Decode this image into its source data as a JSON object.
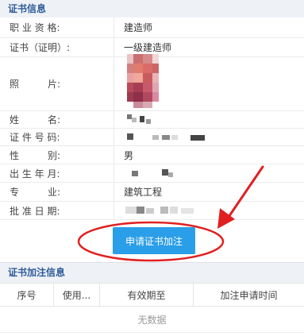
{
  "cert_info": {
    "title": "证书信息",
    "rows": [
      {
        "label": "职 业 资 格:",
        "value": "建造师"
      },
      {
        "label": "证书（证明）:",
        "value": "一级建造师"
      },
      {
        "label": "照　　　片:",
        "value": ""
      },
      {
        "label": "姓　　　名:",
        "value": ""
      },
      {
        "label": "证 件 号 码:",
        "value": ""
      },
      {
        "label": "性　　　别:",
        "value": "男"
      },
      {
        "label": "出 生 年 月:",
        "value": ""
      },
      {
        "label": "专　　　业:",
        "value": "建筑工程"
      },
      {
        "label": "批 准 日 期:",
        "value": ""
      }
    ]
  },
  "apply_button": {
    "label": "申请证书加注"
  },
  "annotation": {
    "color": "#e02020"
  },
  "endorsement_info": {
    "title": "证书加注信息",
    "columns": [
      "序号",
      "使用...",
      "有效期至",
      "加注申请时间"
    ],
    "empty_text": "无数据"
  }
}
